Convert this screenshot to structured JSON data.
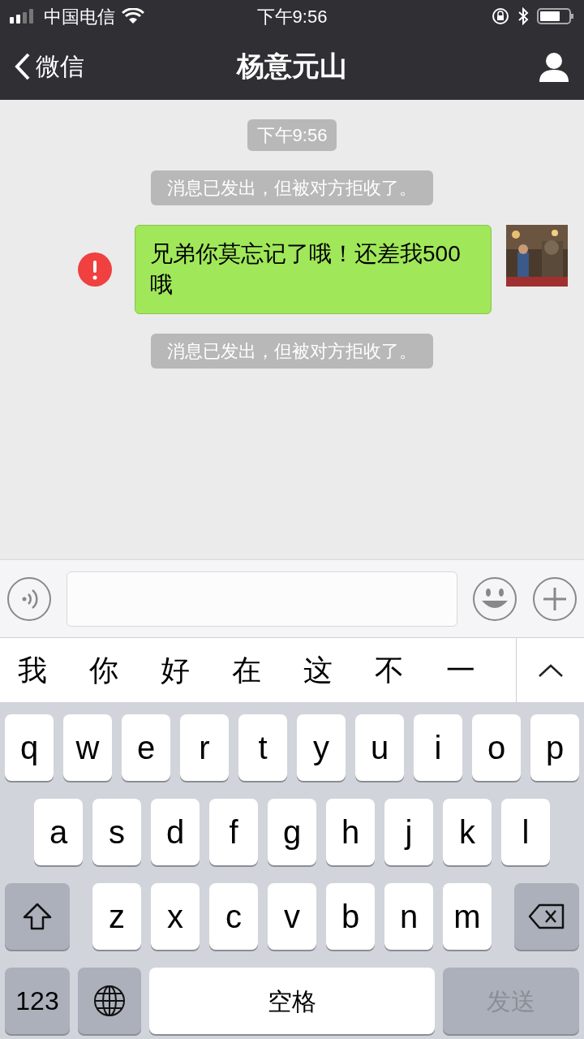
{
  "status_bar": {
    "carrier": "中国电信",
    "time": "下午9:56"
  },
  "nav": {
    "back_label": "微信",
    "title": "杨意元山"
  },
  "messages": [
    {
      "kind": "time",
      "text": "下午9:56"
    },
    {
      "kind": "system",
      "text": "消息已发出，但被对方拒收了。"
    },
    {
      "kind": "outgoing",
      "text": "兄弟你莫忘记了哦！还差我500哦",
      "failed": true
    },
    {
      "kind": "system",
      "text": "消息已发出，但被对方拒收了。"
    }
  ],
  "candidates": [
    "我",
    "你",
    "好",
    "在",
    "这",
    "不",
    "一"
  ],
  "keyboard": {
    "rows": [
      [
        "q",
        "w",
        "e",
        "r",
        "t",
        "y",
        "u",
        "i",
        "o",
        "p"
      ],
      [
        "a",
        "s",
        "d",
        "f",
        "g",
        "h",
        "j",
        "k",
        "l"
      ],
      [
        "z",
        "x",
        "c",
        "v",
        "b",
        "n",
        "m"
      ]
    ],
    "numbers_key": "123",
    "space_key": "空格",
    "send_key": {
      "label": "发送",
      "disabled": true
    }
  }
}
